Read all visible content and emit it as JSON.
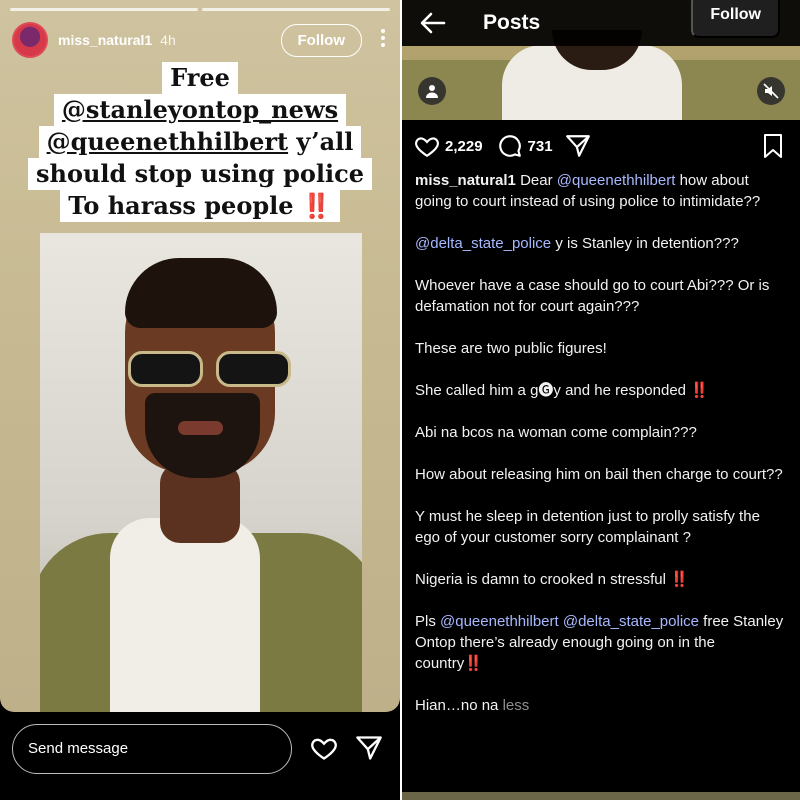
{
  "story": {
    "username": "miss_natural1",
    "time": "4h",
    "follow_label": "Follow",
    "caption": {
      "line1": "Free",
      "line2": "@stanleyontop_news",
      "line3_handle": "@queenethhilbert",
      "line3_rest": " y’all",
      "line4": "should stop using police",
      "line5": "To harass people",
      "bang": "‼️"
    },
    "message_placeholder": "Send message"
  },
  "post": {
    "header_title": "Posts",
    "follow_label": "Follow",
    "likes": "2,229",
    "comments": "731",
    "author": "miss_natural1",
    "p1_a": "Dear ",
    "p1_mention": "@queenethhilbert",
    "p1_b": " how about going to court instead of using police to intimidate??",
    "p2_mention": "@delta_state_police",
    "p2_b": " y is Stanley in detention???",
    "p3": "Whoever have a case should go to court Abi??? Or is defamation not for court again???",
    "p4": "These are two public figures!",
    "p5": "She called him a g🅖y and he responded ",
    "p6": "Abi na bcos na woman come complain???",
    "p7": "How about releasing him on bail then charge to court??",
    "p8": "Y must he sleep in detention just to prolly satisfy the ego of your customer sorry complainant ?",
    "p9": "Nigeria is damn to crooked n stressful ",
    "p10_a": "Pls ",
    "p10_m1": "@queenethhilbert",
    "p10_m2": "@delta_state_police",
    "p10_b": " free Stanley Ontop there’s already enough going on in the country",
    "p11": "Hian…no na ",
    "more": "less",
    "bang": "‼️"
  },
  "icons": {
    "story_more": "more-vertical-icon",
    "heart": "heart-icon",
    "send": "send-icon",
    "back": "back-arrow-icon",
    "comment": "comment-icon",
    "share": "share-icon",
    "bookmark": "bookmark-icon",
    "user": "user-tag-icon",
    "mute": "mute-icon"
  },
  "colors": {
    "mention": "#a8b8ff",
    "alert": "#e22222"
  }
}
